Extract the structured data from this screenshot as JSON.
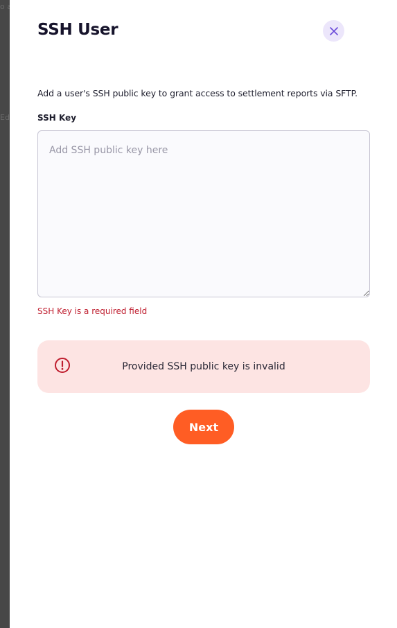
{
  "backdrop": {
    "fragments": [
      "o a",
      "Ed"
    ]
  },
  "drawer": {
    "title": "SSH User",
    "close_icon": "close-icon"
  },
  "form": {
    "description": "Add a user's SSH public key to grant access to settlement reports via SFTP.",
    "ssh_key": {
      "label": "SSH Key",
      "value": "",
      "placeholder": "Add SSH public key here",
      "error": "SSH Key is a required field"
    }
  },
  "alert": {
    "icon": "alert-circle-icon",
    "message": "Provided SSH public key is invalid"
  },
  "actions": {
    "next_label": "Next"
  },
  "colors": {
    "accent": "#ff5d24",
    "error": "#bf1d2e",
    "alert_bg": "#fde4e3",
    "close_bg": "#ece6fb",
    "close_icon": "#6b4bd9"
  }
}
